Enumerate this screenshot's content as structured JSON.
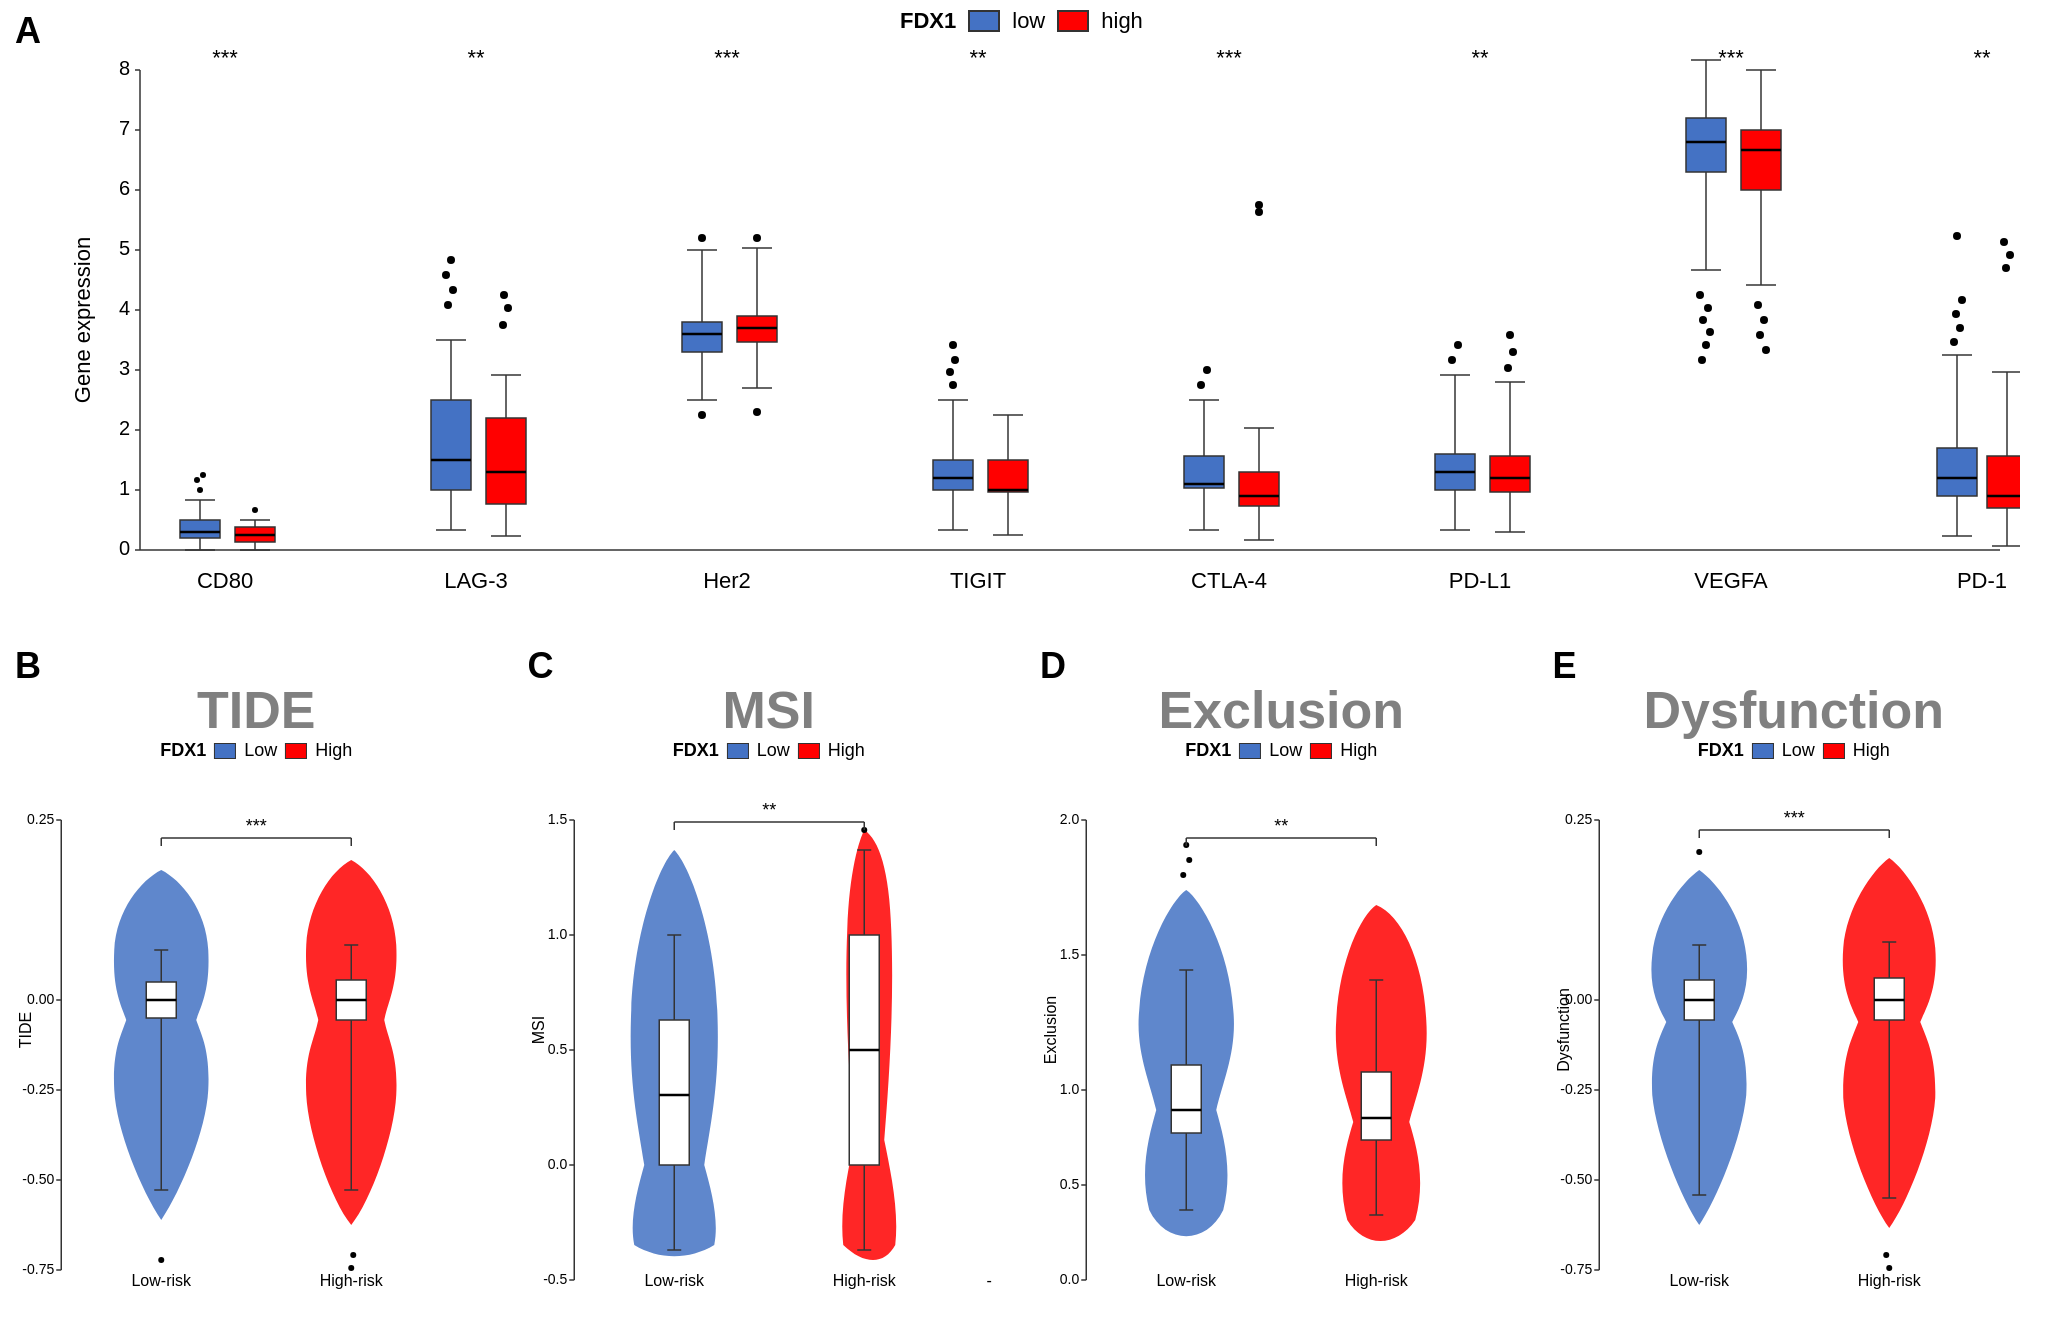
{
  "panel_a": {
    "label": "A",
    "legend_title": "FDX1",
    "legend_low": "low",
    "legend_high": "high",
    "y_axis_label": "Gene expression",
    "genes": [
      "CD80",
      "LAG-3",
      "Her2",
      "TIGIT",
      "CTLA-4",
      "PD-L1",
      "VEGFA",
      "PD-1"
    ],
    "significance": [
      "***",
      "**",
      "***",
      "**",
      "***",
      "**",
      "***",
      "**"
    ],
    "colors": {
      "low": "#4472C4",
      "high": "#FF0000"
    }
  },
  "panel_b": {
    "label": "B",
    "title": "TIDE",
    "legend_title": "FDX1",
    "legend_low": "Low",
    "legend_high": "High",
    "significance": "***",
    "y_label": "TIDE",
    "x_labels": [
      "Low-risk",
      "High-risk"
    ]
  },
  "panel_c": {
    "label": "C",
    "title": "MSI",
    "legend_title": "FDX1",
    "legend_low": "Low",
    "legend_high": "High",
    "significance": "**",
    "y_label": "MSI",
    "x_labels": [
      "Low-risk",
      "High-risk"
    ]
  },
  "panel_d": {
    "label": "D",
    "title": "Exclusion",
    "legend_title": "FDX1",
    "legend_low": "Low",
    "legend_high": "High",
    "significance": "**",
    "y_label": "Exclusion",
    "x_labels": [
      "Low-risk",
      "High-risk"
    ]
  },
  "panel_e": {
    "label": "E",
    "title": "Dysfunction",
    "legend_title": "FDX1",
    "legend_low": "Low",
    "legend_high": "High",
    "significance": "***",
    "y_label": "Dysfunction",
    "x_labels": [
      "Low-risk",
      "High-risk"
    ]
  }
}
